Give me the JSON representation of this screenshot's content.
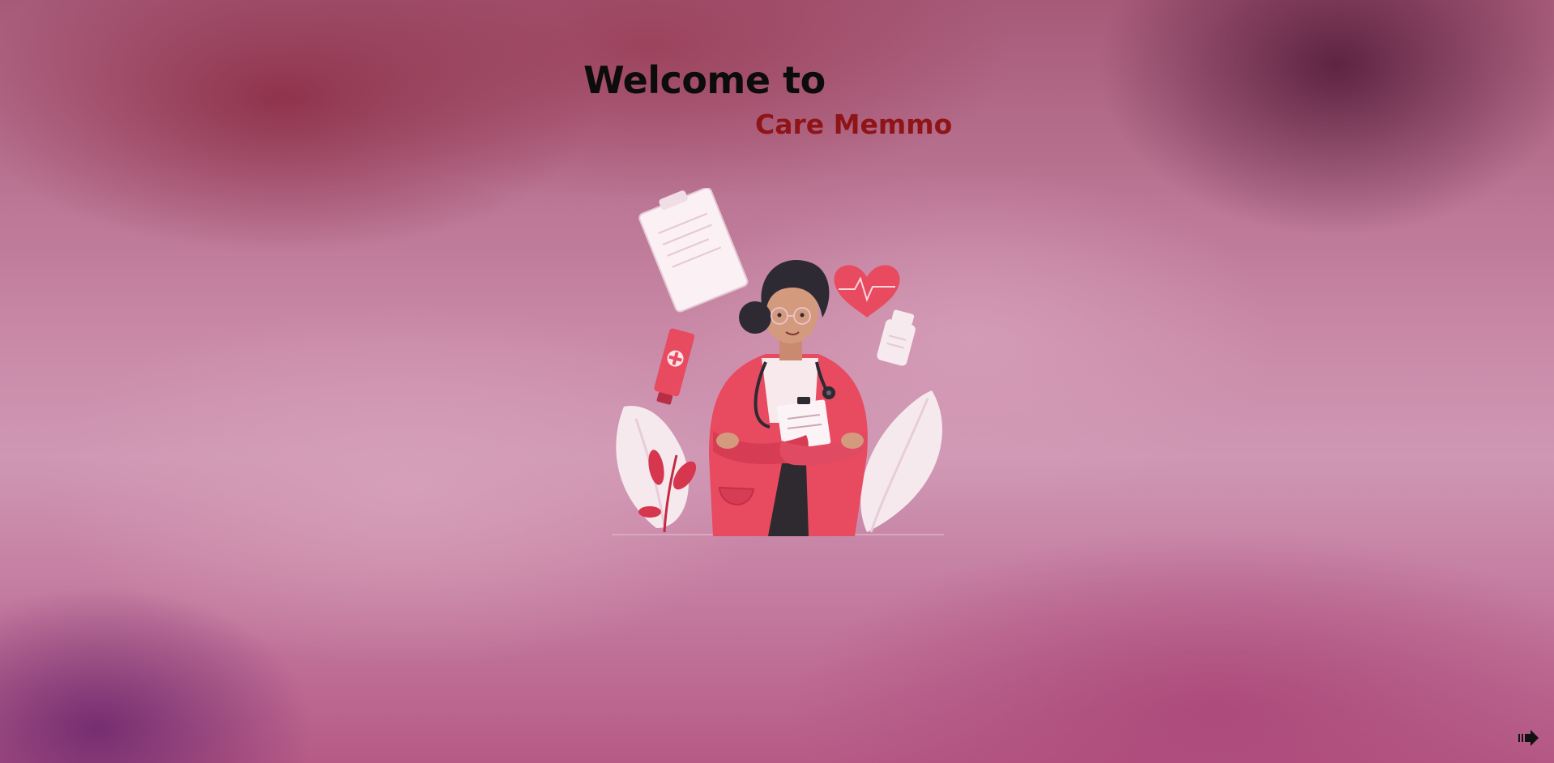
{
  "welcome": {
    "title": "Welcome to",
    "app_name": "Care Memmo"
  },
  "illustration": {
    "icon": "doctor-illustration"
  },
  "navigation": {
    "next_icon": "arrow-right-icon"
  },
  "colors": {
    "title": "#0c0c0c",
    "app_name": "#8e1418",
    "accent": "#e84a5f"
  }
}
